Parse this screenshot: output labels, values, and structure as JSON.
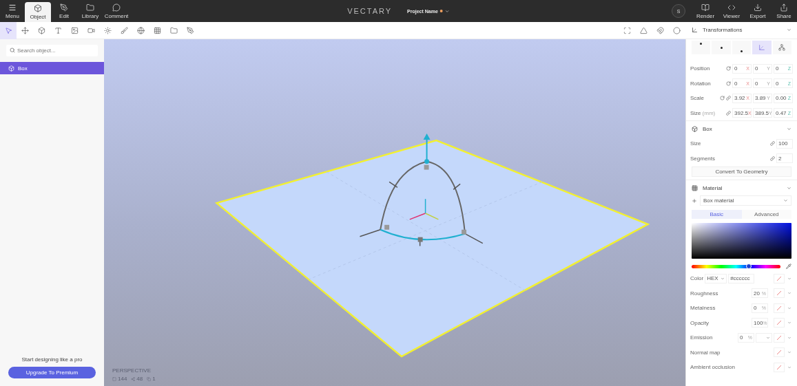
{
  "top_bar": {
    "menu_label": "Menu",
    "tabs": [
      {
        "label": "Object",
        "kind": "object",
        "selected": true
      },
      {
        "label": "Edit",
        "kind": "edit",
        "selected": false
      },
      {
        "label": "Library",
        "kind": "library",
        "selected": false
      },
      {
        "label": "Comment",
        "kind": "comment",
        "selected": false
      }
    ],
    "logo": "VECTARY",
    "project_name": "Project Name",
    "user_initial": "S",
    "actions": [
      {
        "label": "Render",
        "kind": "render"
      },
      {
        "label": "Viewer",
        "kind": "viewer"
      },
      {
        "label": "Export",
        "kind": "export"
      },
      {
        "label": "Share",
        "kind": "share"
      }
    ]
  },
  "toolbar": {
    "tools": [
      {
        "kind": "select",
        "selected": true
      },
      {
        "kind": "move",
        "selected": false
      },
      {
        "kind": "cube",
        "selected": false
      },
      {
        "kind": "text",
        "selected": false
      },
      {
        "kind": "image",
        "selected": false
      },
      {
        "kind": "camera",
        "selected": false
      },
      {
        "kind": "light",
        "selected": false
      },
      {
        "kind": "brush",
        "selected": false
      },
      {
        "kind": "sphere",
        "selected": false
      },
      {
        "kind": "grid",
        "selected": false
      },
      {
        "kind": "folder",
        "selected": false
      },
      {
        "kind": "edit",
        "selected": false
      }
    ],
    "view_tools": [
      {
        "kind": "focus"
      },
      {
        "kind": "shading"
      },
      {
        "kind": "snap"
      },
      {
        "kind": "circle"
      }
    ]
  },
  "sidebar": {
    "search": {
      "placeholder": "Search object..."
    },
    "items": [
      {
        "label": "Box",
        "selected": true
      }
    ],
    "promo_text": "Start designing like a pro",
    "upgrade_button": "Upgrade To Premium"
  },
  "viewport": {
    "camera_label": "PERSPECTIVE",
    "stats": [
      {
        "kind": "vertices",
        "value": "144"
      },
      {
        "kind": "edges",
        "value": "48"
      },
      {
        "kind": "objects",
        "value": "1"
      }
    ]
  },
  "panel": {
    "transformations": {
      "title": "Transformations",
      "pivot_options": [
        {
          "kind": "dot-top",
          "selected": false
        },
        {
          "kind": "dot-middle",
          "selected": false
        },
        {
          "kind": "dot-bottom",
          "selected": false
        },
        {
          "kind": "local",
          "selected": true
        },
        {
          "kind": "world",
          "selected": false
        }
      ],
      "rows": [
        {
          "label": "Position",
          "reset": true,
          "linked": false,
          "values": [
            {
              "value": "0",
              "axis": "X"
            },
            {
              "value": "0",
              "axis": "Y"
            },
            {
              "value": "0",
              "axis": "Z"
            }
          ]
        },
        {
          "label": "Rotation",
          "reset": true,
          "linked": false,
          "values": [
            {
              "value": "0",
              "axis": "X"
            },
            {
              "value": "0",
              "axis": "Y"
            },
            {
              "value": "0",
              "axis": "Z"
            }
          ]
        },
        {
          "label": "Scale",
          "reset": true,
          "linked": true,
          "values": [
            {
              "value": "3.92",
              "axis": "X"
            },
            {
              "value": "3.89",
              "axis": "Y"
            },
            {
              "value": "0.00",
              "axis": "Z"
            }
          ]
        },
        {
          "label": "Size",
          "unit": "(mm)",
          "reset": false,
          "linked": true,
          "values": [
            {
              "value": "392.5",
              "axis": "X"
            },
            {
              "value": "389.5",
              "axis": "Y"
            },
            {
              "value": "0.47",
              "axis": "Z"
            }
          ]
        }
      ]
    },
    "box": {
      "title": "Box",
      "rows": [
        {
          "label": "Size",
          "value": "100"
        },
        {
          "label": "Segments",
          "value": "2"
        }
      ],
      "convert_button": "Convert To Geometry"
    },
    "material": {
      "title": "Material",
      "material_select": "Box material",
      "tabs": [
        {
          "label": "Basic",
          "selected": true
        },
        {
          "label": "Advanced",
          "selected": false
        }
      ],
      "hue": {
        "level": 0.64
      },
      "color": {
        "label": "Color",
        "format": "HEX",
        "value": "#cccccc"
      },
      "properties": [
        {
          "kind": "percent",
          "label": "Roughness",
          "value": "20",
          "unit": "%"
        },
        {
          "kind": "percent",
          "label": "Metalness",
          "value": "0",
          "unit": "%"
        },
        {
          "kind": "percent",
          "label": "Opacity",
          "value": "100",
          "unit": "%"
        },
        {
          "kind": "emission",
          "label": "Emission",
          "value": "0",
          "unit": "%"
        },
        {
          "kind": "map",
          "label": "Normal map"
        },
        {
          "kind": "map",
          "label": "Ambient occlusion"
        }
      ]
    }
  }
}
